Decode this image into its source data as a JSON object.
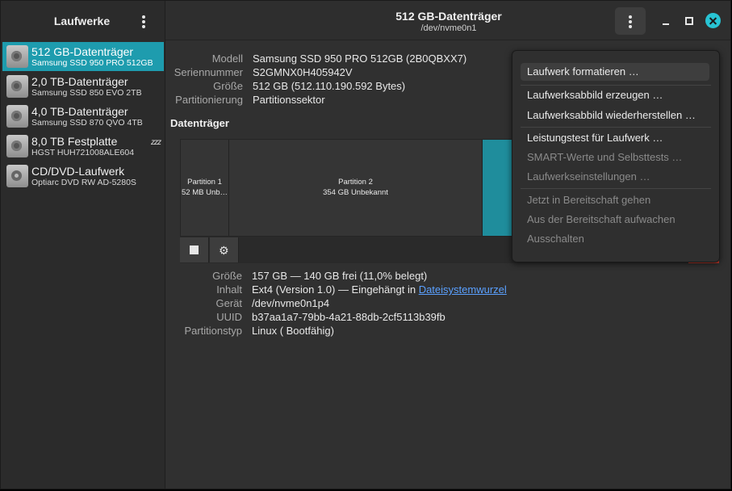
{
  "sidebar": {
    "title": "Laufwerke",
    "devices": [
      {
        "name": "512 GB-Datenträger",
        "sub": "Samsung SSD 950 PRO 512GB",
        "selected": true,
        "icon": "drive-icon"
      },
      {
        "name": "2,0 TB-Datenträger",
        "sub": "Samsung SSD 850 EVO 2TB",
        "icon": "drive-icon"
      },
      {
        "name": "4,0 TB-Datenträger",
        "sub": "Samsung SSD 870 QVO 4TB",
        "icon": "drive-icon"
      },
      {
        "name": "8,0 TB Festplatte",
        "sub": "HGST HUH721008ALE604",
        "icon": "drive-icon",
        "badge": "zzz"
      },
      {
        "name": "CD/DVD-Laufwerk",
        "sub": "Optiarc DVD RW AD-5280S",
        "icon": "optical-drive-icon"
      }
    ]
  },
  "header": {
    "title": "512 GB-Datenträger",
    "subtitle": "/dev/nvme0n1"
  },
  "drive": {
    "fields": [
      {
        "key": "Modell",
        "value": "Samsung SSD 950 PRO 512GB (2B0QBXX7)"
      },
      {
        "key": "Seriennummer",
        "value": "S2GMNX0H405942V"
      },
      {
        "key": "Größe",
        "value": "512 GB (512.110.190.592 Bytes)"
      },
      {
        "key": "Partitionierung",
        "value": "Partitionssektor"
      }
    ]
  },
  "volumes": {
    "title": "Datenträger",
    "partitions": [
      {
        "name": "Partition 1",
        "size": "52 MB Unb…"
      },
      {
        "name": "Partition 2",
        "size": "354 GB Unbekannt"
      },
      {
        "name": "",
        "size": "",
        "selected": true
      }
    ]
  },
  "partition_info": {
    "size_key": "Größe",
    "size_value": "157 GB — 140 GB frei (11,0% belegt)",
    "content_key": "Inhalt",
    "content_value": "Ext4 (Version 1.0) — Eingehängt in ",
    "content_link": "Dateisystemwurzel",
    "device_key": "Gerät",
    "device_value": "/dev/nvme0n1p4",
    "uuid_key": "UUID",
    "uuid_value": "b37aa1a7-79bb-4a21-88db-2cf5113b39fb",
    "type_key": "Partitionstyp",
    "type_value": "Linux ( Bootfähig)"
  },
  "menu": {
    "items": [
      {
        "label": "Laufwerk formatieren …",
        "enabled": true,
        "highlighted": true
      },
      {
        "label": "Laufwerksabbild erzeugen …",
        "enabled": true
      },
      {
        "label": "Laufwerksabbild wiederherstellen …",
        "enabled": true
      },
      {
        "label": "Leistungstest für Laufwerk …",
        "enabled": true
      },
      {
        "label": "SMART-Werte und Selbsttests …",
        "enabled": false
      },
      {
        "label": "Laufwerkseinstellungen …",
        "enabled": false
      },
      {
        "label": "Jetzt in Bereitschaft gehen",
        "enabled": false
      },
      {
        "label": "Aus der Bereitschaft aufwachen",
        "enabled": false
      },
      {
        "label": "Ausschalten",
        "enabled": false
      }
    ]
  },
  "colors": {
    "accent": "#1e9cae",
    "close": "#28c4d4",
    "danger": "#c0392b",
    "link": "#5aa0ff"
  }
}
